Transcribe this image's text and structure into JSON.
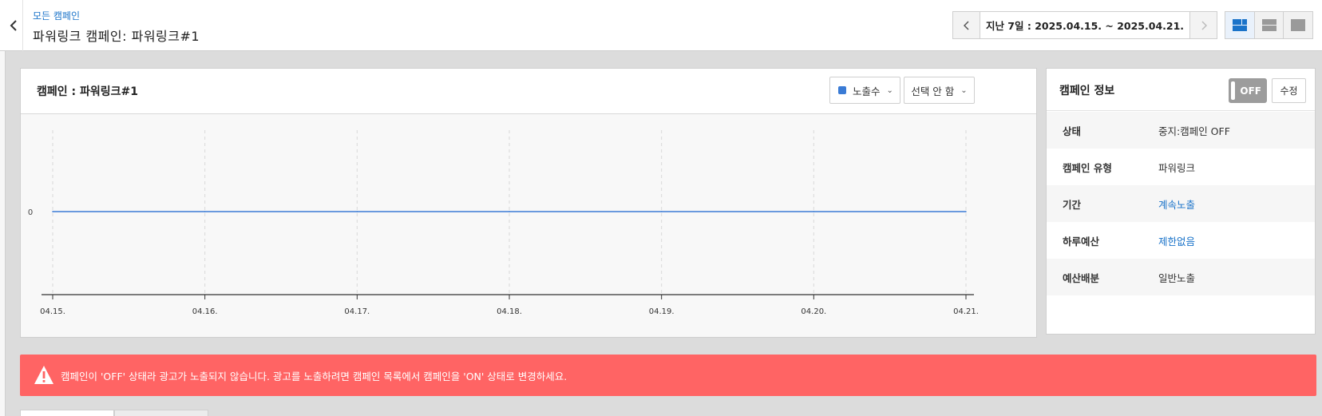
{
  "header": {
    "back_icon": "chevron-left-icon",
    "breadcrumb": "모든 캠페인",
    "title": "파워링크 캠페인: 파워링크#1",
    "date_range": "지난 7일 : 2025.04.15. ~ 2025.04.21.",
    "views": [
      "view-split-icon",
      "view-rows-icon",
      "view-single-icon"
    ],
    "active_view_color": "#1a73c9"
  },
  "chart_panel": {
    "title": "캠페인 : 파워링크#1",
    "metric1": {
      "label": "노출수",
      "swatch": "#3a7bd5"
    },
    "metric2": {
      "label": "선택 안 함"
    }
  },
  "chart_data": {
    "type": "line",
    "x": [
      "04.15.",
      "04.16.",
      "04.17.",
      "04.18.",
      "04.19.",
      "04.20.",
      "04.21."
    ],
    "series": [
      {
        "name": "노출수",
        "values": [
          0,
          0,
          0,
          0,
          0,
          0,
          0
        ],
        "color": "#3a7bd5"
      }
    ],
    "yticks": [
      "0"
    ],
    "grid": "vertical dashed"
  },
  "info_panel": {
    "title": "캠페인 정보",
    "toggle": "OFF",
    "edit": "수정",
    "rows": [
      {
        "label": "상태",
        "value": "중지:캠페인 OFF"
      },
      {
        "label": "캠페인 유형",
        "value": "파워링크"
      },
      {
        "label": "기간",
        "value": "계속노출"
      },
      {
        "label": "하루예산",
        "value": "제한없음"
      },
      {
        "label": "예산배분",
        "value": "일반노출"
      }
    ]
  },
  "alert": {
    "icon": "warning-icon",
    "message": "캠페인이 'OFF' 상태라 광고가 노출되지 않습니다. 광고를 노출하려면 캠페인 목록에서 캠페인을 'ON' 상태로 변경하세요.",
    "color": "#ff6464"
  }
}
